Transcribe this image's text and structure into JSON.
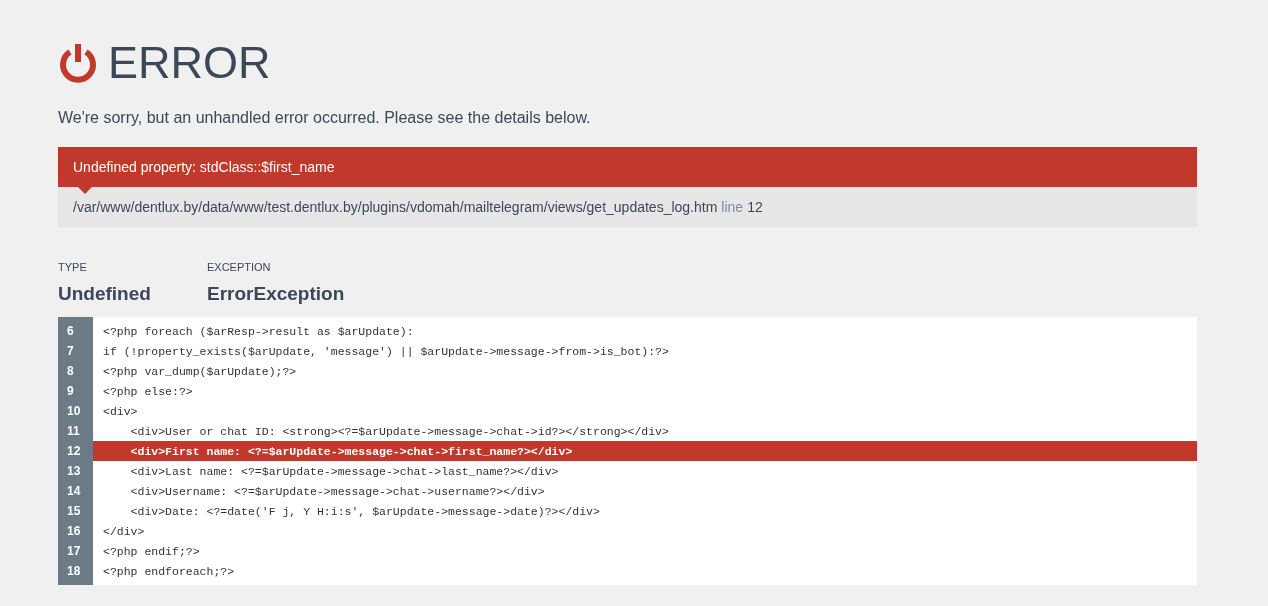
{
  "title": "ERROR",
  "message": "We're sorry, but an unhandled error occurred. Please see the details below.",
  "error": {
    "text": "Undefined property: stdClass::$first_name",
    "file": "/var/www/dentlux.by/data/www/test.dentlux.by/plugins/vdomah/mailtelegram/views/get_updates_log.htm",
    "line_label": "line",
    "line": "12"
  },
  "details": [
    {
      "label": "TYPE",
      "value": "Undefined"
    },
    {
      "label": "EXCEPTION",
      "value": "ErrorException"
    }
  ],
  "code_lines": [
    {
      "number": "6",
      "code": "<?php foreach ($arResp->result as $arUpdate):",
      "highlighted": false
    },
    {
      "number": "7",
      "code": "if (!property_exists($arUpdate, 'message') || $arUpdate->message->from->is_bot):?>",
      "highlighted": false
    },
    {
      "number": "8",
      "code": "<?php var_dump($arUpdate);?>",
      "highlighted": false
    },
    {
      "number": "9",
      "code": "<?php else:?>",
      "highlighted": false
    },
    {
      "number": "10",
      "code": "<div>",
      "highlighted": false
    },
    {
      "number": "11",
      "code": "    <div>User or chat ID: <strong><?=$arUpdate->message->chat->id?></strong></div>",
      "highlighted": false
    },
    {
      "number": "12",
      "code": "    <div>First name: <?=$arUpdate->message->chat->first_name?></div>",
      "highlighted": true
    },
    {
      "number": "13",
      "code": "    <div>Last name: <?=$arUpdate->message->chat->last_name?></div>",
      "highlighted": false
    },
    {
      "number": "14",
      "code": "    <div>Username: <?=$arUpdate->message->chat->username?></div>",
      "highlighted": false
    },
    {
      "number": "15",
      "code": "    <div>Date: <?=date('F j, Y H:i:s', $arUpdate->message->date)?></div>",
      "highlighted": false
    },
    {
      "number": "16",
      "code": "</div>",
      "highlighted": false
    },
    {
      "number": "17",
      "code": "<?php endif;?>",
      "highlighted": false
    },
    {
      "number": "18",
      "code": "<?php endforeach;?>",
      "highlighted": false
    }
  ]
}
